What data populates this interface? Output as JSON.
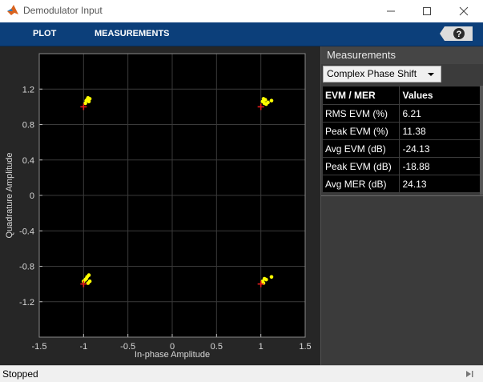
{
  "window": {
    "title": "Demodulator Input"
  },
  "ribbon": {
    "tabs": [
      "PLOT",
      "MEASUREMENTS"
    ],
    "help_label": "?"
  },
  "measurements": {
    "header": "Measurements",
    "dropdown_value": "Complex Phase Shift",
    "table": {
      "columns": [
        "EVM / MER",
        "Values"
      ],
      "rows": [
        [
          "RMS EVM (%)",
          "6.21"
        ],
        [
          "Peak EVM (%)",
          "11.38"
        ],
        [
          "Avg EVM (dB)",
          "-24.13"
        ],
        [
          "Peak EVM (dB)",
          "-18.88"
        ],
        [
          "Avg MER (dB)",
          "24.13"
        ]
      ]
    }
  },
  "status": {
    "text": "Stopped"
  },
  "colors": {
    "ribbon": "#0c3f7a",
    "plot_bg": "#000000",
    "panel_bg": "#262626",
    "points": "#ffff00",
    "reference": "#e81d1d"
  },
  "chart_data": {
    "type": "scatter",
    "xlabel": "In-phase Amplitude",
    "ylabel": "Quadrature Amplitude",
    "xlim": [
      -1.5,
      1.5
    ],
    "ylim": [
      -1.6,
      1.6
    ],
    "xticks": [
      "-1.5",
      "-1",
      "-0.5",
      "0",
      "0.5",
      "1",
      "1.5"
    ],
    "yticks": [
      "1.2",
      "0.8",
      "0.4",
      "0",
      "-0.4",
      "-0.8",
      "-1.2"
    ],
    "grid": true,
    "series": [
      {
        "marker": "dot",
        "color": "#ffff00",
        "points": [
          [
            -0.97,
            1.07
          ],
          [
            -0.95,
            1.1
          ],
          [
            -0.93,
            1.09
          ],
          [
            -0.98,
            1.04
          ],
          [
            -0.94,
            1.06
          ],
          [
            -0.96,
            1.08
          ],
          [
            1.02,
            1.06
          ],
          [
            1.05,
            1.08
          ],
          [
            1.08,
            1.05
          ],
          [
            1.12,
            1.07
          ],
          [
            1.04,
            1.04
          ],
          [
            1.06,
            1.03
          ],
          [
            1.03,
            1.09
          ],
          [
            -0.98,
            -0.95
          ],
          [
            -0.96,
            -0.92
          ],
          [
            -0.93,
            -0.97
          ],
          [
            -1.0,
            -0.97
          ],
          [
            -0.94,
            -0.9
          ],
          [
            -0.95,
            -0.99
          ],
          [
            -0.97,
            -0.94
          ],
          [
            1.02,
            -0.97
          ],
          [
            1.04,
            -0.94
          ],
          [
            1.06,
            -0.95
          ],
          [
            1.12,
            -0.92
          ],
          [
            1.03,
            -0.99
          ]
        ]
      },
      {
        "marker": "plus",
        "color": "#e81d1d",
        "points": [
          [
            -1,
            1
          ],
          [
            1,
            1
          ],
          [
            -1,
            -1
          ],
          [
            1,
            -1
          ]
        ]
      }
    ]
  }
}
